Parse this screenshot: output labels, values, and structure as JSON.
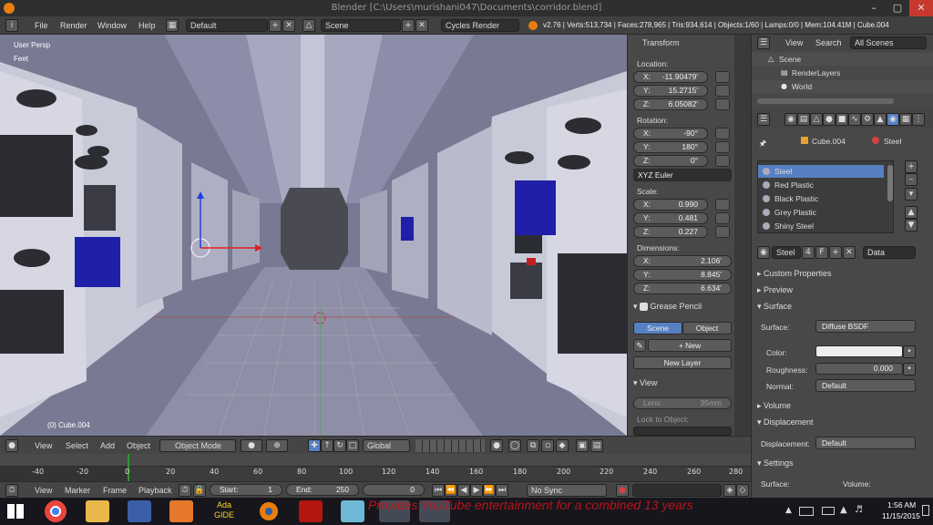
{
  "window": {
    "title": "Blender [C:\\Users\\murishani047\\Documents\\corridor.blend]"
  },
  "infobar": {
    "menus": [
      "File",
      "Render",
      "Window",
      "Help"
    ],
    "layout": "Default",
    "scene": "Scene",
    "engine": "Cycles Render",
    "stats": "v2.76 | Verts:513,734 | Faces:278,965 | Tris:934,614 | Objects:1/60 | Lamps:0/0 | Mem:104.41M | Cube.004"
  },
  "viewport": {
    "view_name": "User Persp",
    "units": "Feet",
    "active_object": "(0) Cube.004"
  },
  "npanel": {
    "transform_title": "Transform",
    "location_label": "Location:",
    "location": [
      {
        "k": "X:",
        "v": "-11.90479'"
      },
      {
        "k": "Y:",
        "v": "15.2715'"
      },
      {
        "k": "Z:",
        "v": "6.05082'"
      }
    ],
    "rotation_label": "Rotation:",
    "rotation": [
      {
        "k": "X:",
        "v": "-90°"
      },
      {
        "k": "Y:",
        "v": "180°"
      },
      {
        "k": "Z:",
        "v": "0°"
      }
    ],
    "rotation_mode": "XYZ Euler",
    "scale_label": "Scale:",
    "scale": [
      {
        "k": "X:",
        "v": "0.990"
      },
      {
        "k": "Y:",
        "v": "0.481"
      },
      {
        "k": "Z:",
        "v": "0.227"
      }
    ],
    "dimensions_label": "Dimensions:",
    "dimensions": [
      {
        "k": "X:",
        "v": "2.106'"
      },
      {
        "k": "Y:",
        "v": "8.845'"
      },
      {
        "k": "Z:",
        "v": "6.634'"
      }
    ],
    "grease_title": "Grease Pencil",
    "gp_scene": "Scene",
    "gp_object": "Object",
    "gp_new": "New",
    "gp_new_layer": "New Layer",
    "view_title": "View",
    "lens_label": "Lens:",
    "lens_value": "35mm",
    "lock_label": "Lock to Object:"
  },
  "outliner": {
    "menus": [
      "View",
      "Search"
    ],
    "filter": "All Scenes",
    "items": [
      "Scene",
      "RenderLayers",
      "World"
    ]
  },
  "props": {
    "breadcrumb_object": "Cube.004",
    "breadcrumb_material": "Steel",
    "materials": [
      "Steel",
      "Red Plastic",
      "Black Plastic",
      "Grey Plastic",
      "Shiny Steel"
    ],
    "mat_name": "Steel",
    "mat_users": "4",
    "mat_f": "F",
    "link_mode": "Data",
    "panels": {
      "custom": "Custom Properties",
      "preview": "Preview",
      "surface": "Surface",
      "volume": "Volume",
      "displacement": "Displacement",
      "settings": "Settings"
    },
    "surface_label": "Surface:",
    "surface_value": "Diffuse BSDF",
    "color_label": "Color:",
    "roughness_label": "Roughness:",
    "roughness_value": "0.000",
    "normal_label": "Normal:",
    "normal_value": "Default",
    "displacement_label": "Displacement:",
    "displacement_value": "Default",
    "settings_surface": "Surface:",
    "settings_volume": "Volume:"
  },
  "vp_header": {
    "menus": [
      "View",
      "Select",
      "Add",
      "Object"
    ],
    "mode": "Object Mode",
    "orientation": "Global"
  },
  "timeline": {
    "ticks": [
      "-40",
      "-20",
      "0",
      "20",
      "40",
      "60",
      "80",
      "100",
      "120",
      "140",
      "160",
      "180",
      "200",
      "220",
      "240",
      "260",
      "280"
    ],
    "menus": [
      "View",
      "Marker",
      "Frame",
      "Playback"
    ],
    "start_label": "Start:",
    "start_value": "1",
    "end_label": "End:",
    "end_value": "250",
    "current_frame": "0",
    "sync": "No Sync"
  },
  "taskbar": {
    "watermark": "Provides YouTube entertainment for a combined 13 years",
    "time": "1:56 AM",
    "date": "11/15/2015",
    "app_label": "Ada GIDE"
  },
  "colors": {
    "accent": "#5680c2",
    "header_bg": "#454545",
    "panel_bg": "#484848"
  }
}
